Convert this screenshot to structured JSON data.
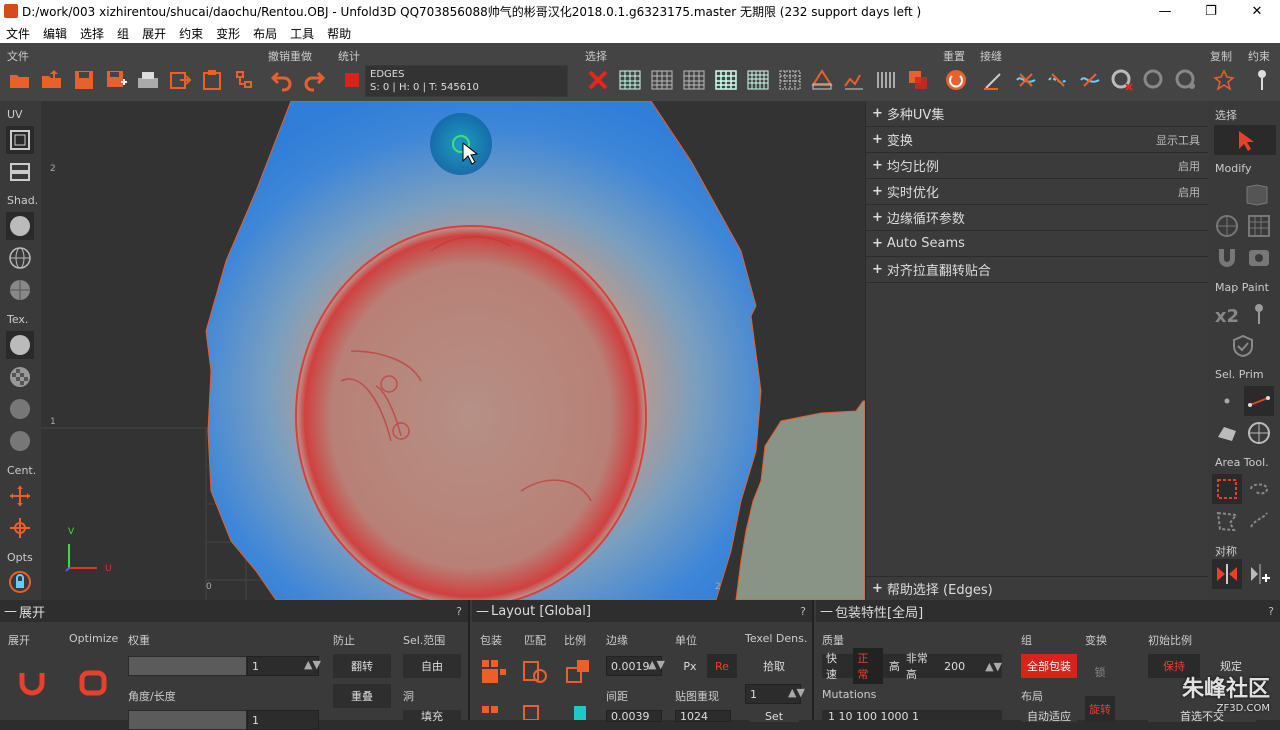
{
  "titlebar": {
    "title": "D:/work/003 xizhirentou/shucai/daochu/Rentou.OBJ - Unfold3D QQ703856088帅气的彬哥汉化2018.0.1.g6323175.master 无期限 (232 support days left )",
    "min": "—",
    "max": "❐",
    "close": "✕"
  },
  "menu": [
    "文件",
    "编辑",
    "选择",
    "组",
    "展开",
    "约束",
    "变形",
    "布局",
    "工具",
    "帮助"
  ],
  "toolbar": {
    "groups": {
      "file": "文件",
      "undo": "撤销重做",
      "stats": "统计",
      "select": "选择",
      "reset": "重置",
      "seams": "接缝",
      "copy": "复制",
      "constraint": "约束"
    },
    "stats_mode": "EDGES",
    "stats_values": "S: 0 | H: 0 | T: 545610"
  },
  "leftbar": {
    "uv": "UV",
    "shad": "Shad.",
    "tex": "Tex.",
    "cent": "Cent.",
    "opts": "Opts"
  },
  "viewport": {
    "tick_2": "2",
    "tick_1": "1",
    "axis_v": "V",
    "axis_u": "U",
    "origin": "0",
    "grid_2": "2"
  },
  "rightpanel": {
    "rows": [
      {
        "label": "多种UV集",
        "right": ""
      },
      {
        "label": "变换",
        "right": "显示工具"
      },
      {
        "label": "均匀比例",
        "right": "启用"
      },
      {
        "label": "实时优化",
        "right": "启用"
      },
      {
        "label": "边缘循环参数",
        "right": ""
      },
      {
        "label": "Auto Seams",
        "right": ""
      },
      {
        "label": "对齐拉直翻转贴合",
        "right": ""
      }
    ],
    "help": "帮助选择 (Edges)"
  },
  "sidebar": {
    "select": "选择",
    "modify": "Modify",
    "mappaint": "Map Paint",
    "x2": "x2",
    "selprim": "Sel. Prim",
    "areatool": "Area Tool.",
    "symmetry": "对称"
  },
  "panel_unfold": {
    "title": "展开",
    "help": "?",
    "h_unfold": "展开",
    "h_optimize": "Optimize",
    "h_weight": "权重",
    "h_prevent": "防止",
    "h_selrange": "Sel.范围",
    "weight_val": "1",
    "angle_label": "角度/长度",
    "angle_val": "1",
    "btn_flip": "翻转",
    "btn_free": "自由",
    "btn_overlap": "重叠",
    "btn_hole": "洞",
    "btn_fill": "填充"
  },
  "panel_layout": {
    "title": "Layout [Global]",
    "help": "?",
    "h_pack": "包装",
    "h_match": "匹配",
    "h_ratio": "比例",
    "h_margin": "边缘",
    "h_unit": "单位",
    "h_texel": "Texel Dens.",
    "margin_val": "0.0019",
    "px": "Px",
    "re": "Re",
    "pick": "拾取",
    "spacing_label": "间距",
    "tile_label": "贴图重现",
    "tile_val": "1",
    "spacing_val": "0.0039",
    "res_val": "1024",
    "set": "Set"
  },
  "panel_pack": {
    "title": "包装特性[全局]",
    "help": "?",
    "h_quality": "质量",
    "h_group": "组",
    "h_transform": "变换",
    "h_initscale": "初始比例",
    "fast": "快速",
    "normal": "正常",
    "high": "高",
    "veryhigh": "非常高",
    "qval": "200",
    "allpack": "全部包装",
    "lock": "锁",
    "keep": "保持",
    "fixed": "规定",
    "mutations": "Mutations",
    "layout": "布局",
    "mut_vals": "1  10  100  1000  1",
    "autofit": "自动适应",
    "rotate": "旋转",
    "noncross": "首选不交"
  },
  "watermark": {
    "main": "朱峰社区",
    "sub": "ZF3D.COM"
  }
}
